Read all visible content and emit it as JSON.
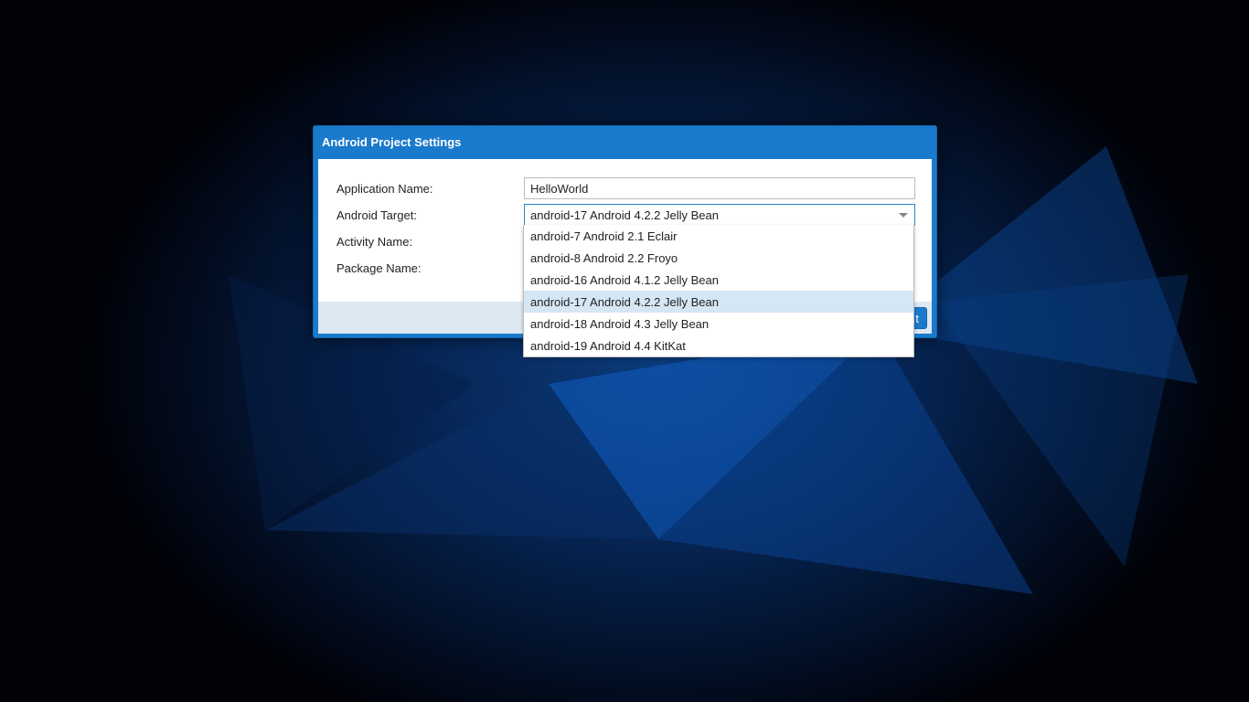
{
  "dialog": {
    "title": "Android Project Settings",
    "fields": {
      "application_name_label": "Application Name:",
      "application_name_value": "HelloWorld",
      "android_target_label": "Android Target:",
      "android_target_value": "android-17 Android 4.2.2 Jelly Bean",
      "activity_name_label": "Activity Name:",
      "package_name_label": "Package Name:"
    },
    "footer": {
      "button_label_visible": "t"
    }
  },
  "dropdown": {
    "options": [
      "android-7 Android 2.1 Eclair",
      "android-8 Android 2.2 Froyo",
      "android-16 Android 4.1.2 Jelly Bean",
      "android-17 Android 4.2.2 Jelly Bean",
      "android-18 Android 4.3 Jelly Bean",
      "android-19 Android 4.4 KitKat"
    ],
    "selected_index": 3
  },
  "colors": {
    "accent": "#1a7acb",
    "selected_row": "#d5e6f5",
    "footer_bg": "#dde8f3"
  },
  "icons": {
    "select_arrow": "chevron-down-icon"
  }
}
